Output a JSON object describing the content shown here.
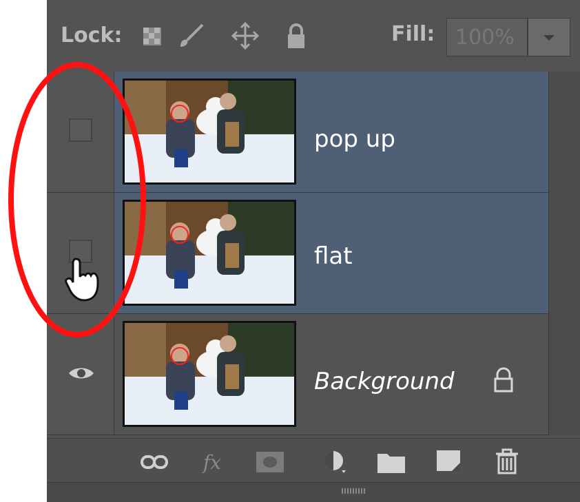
{
  "lock_row": {
    "label": "Lock:",
    "icons": [
      "lock-transparent-icon",
      "lock-paint-icon",
      "lock-position-icon",
      "lock-all-icon"
    ],
    "fill_label": "Fill:",
    "fill_value": "100%"
  },
  "layers": [
    {
      "name": "pop up",
      "visible": false,
      "selected": true
    },
    {
      "name": "flat",
      "visible": false,
      "selected": true
    },
    {
      "name": "Background",
      "visible": true,
      "selected": false,
      "locked": true
    }
  ],
  "toolbar": {
    "icons": [
      "link-layers-icon",
      "layer-style-fx-icon",
      "layer-mask-icon",
      "adjustment-layer-icon",
      "new-group-icon",
      "new-layer-icon",
      "delete-layer-icon"
    ],
    "fx_label": "fx"
  },
  "colors": {
    "panel_bg": "#535353",
    "selected_row": "#4f5f76",
    "annotation_red": "#ff1111"
  }
}
